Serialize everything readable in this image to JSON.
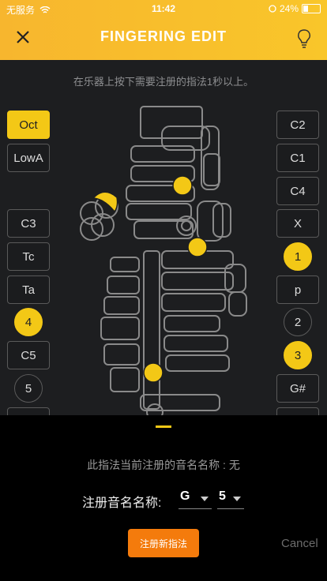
{
  "status_bar": {
    "carrier": "无服务",
    "time": "11:42",
    "battery": "24%"
  },
  "header": {
    "title": "FINGERING EDIT",
    "close_icon": "close-icon",
    "hint_icon": "lightbulb-icon"
  },
  "main": {
    "instruction": "在乐器上按下需要注册的指法1秒以上。"
  },
  "left_keys": [
    {
      "label": "Oct",
      "active": true,
      "shape": "square"
    },
    {
      "label": "LowA",
      "active": false,
      "shape": "square"
    },
    {
      "label": "C3",
      "active": false,
      "shape": "square"
    },
    {
      "label": "Tc",
      "active": false,
      "shape": "square"
    },
    {
      "label": "Ta",
      "active": false,
      "shape": "square"
    },
    {
      "label": "4",
      "active": true,
      "shape": "circle"
    },
    {
      "label": "C5",
      "active": false,
      "shape": "square"
    },
    {
      "label": "5",
      "active": false,
      "shape": "circle"
    }
  ],
  "right_keys": [
    {
      "label": "C2",
      "active": false,
      "shape": "square"
    },
    {
      "label": "C1",
      "active": false,
      "shape": "square"
    },
    {
      "label": "C4",
      "active": false,
      "shape": "square"
    },
    {
      "label": "X",
      "active": false,
      "shape": "square"
    },
    {
      "label": "1",
      "active": true,
      "shape": "circle"
    },
    {
      "label": "p",
      "active": false,
      "shape": "square"
    },
    {
      "label": "2",
      "active": false,
      "shape": "circle"
    },
    {
      "label": "3",
      "active": true,
      "shape": "circle"
    },
    {
      "label": "G#",
      "active": false,
      "shape": "square"
    }
  ],
  "bottom": {
    "current_fingering_info": "此指法当前注册的音名名称 : 无",
    "register_label": "注册音名名称:",
    "note_select": "G",
    "octave_select": "5",
    "register_button": "注册新指法",
    "cancel_button": "Cancel"
  },
  "colors": {
    "accent": "#f3c816",
    "header": "#f9c62a",
    "button": "#f47b0c"
  }
}
